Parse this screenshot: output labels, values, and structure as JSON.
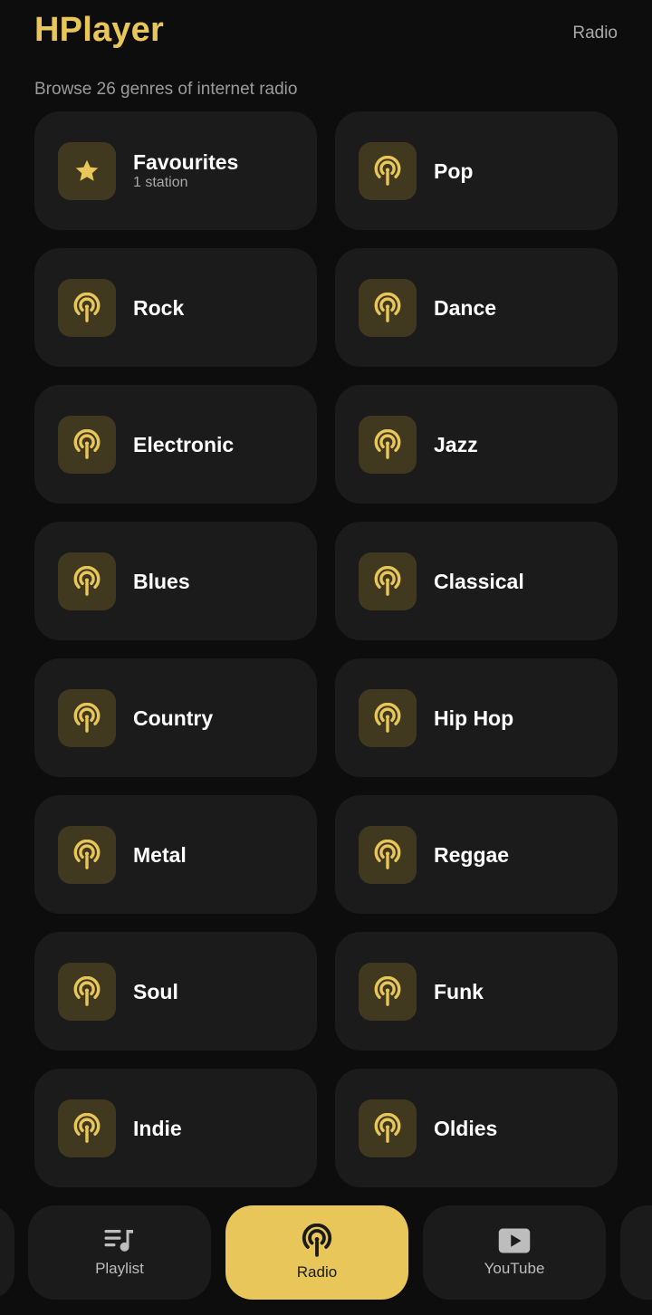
{
  "header": {
    "app_title": "HPlayer",
    "page_label": "Radio"
  },
  "subtitle": "Browse 26 genres of internet radio",
  "colors": {
    "accent": "#e8c65a",
    "card_bg": "#1b1b1b",
    "icon_bg": "#40391f",
    "background": "#0d0d0d"
  },
  "genres": [
    {
      "name": "Favourites",
      "sub": "1 station",
      "icon": "star-icon"
    },
    {
      "name": "Pop",
      "icon": "radio-broadcast-icon"
    },
    {
      "name": "Rock",
      "icon": "radio-broadcast-icon"
    },
    {
      "name": "Dance",
      "icon": "radio-broadcast-icon"
    },
    {
      "name": "Electronic",
      "icon": "radio-broadcast-icon"
    },
    {
      "name": "Jazz",
      "icon": "radio-broadcast-icon"
    },
    {
      "name": "Blues",
      "icon": "radio-broadcast-icon"
    },
    {
      "name": "Classical",
      "icon": "radio-broadcast-icon"
    },
    {
      "name": "Country",
      "icon": "radio-broadcast-icon"
    },
    {
      "name": "Hip Hop",
      "icon": "radio-broadcast-icon"
    },
    {
      "name": "Metal",
      "icon": "radio-broadcast-icon"
    },
    {
      "name": "Reggae",
      "icon": "radio-broadcast-icon"
    },
    {
      "name": "Soul",
      "icon": "radio-broadcast-icon"
    },
    {
      "name": "Funk",
      "icon": "radio-broadcast-icon"
    },
    {
      "name": "Indie",
      "icon": "radio-broadcast-icon"
    },
    {
      "name": "Oldies",
      "icon": "radio-broadcast-icon"
    }
  ],
  "bottom_nav": {
    "items": [
      {
        "label": "Playlist",
        "icon": "playlist-icon",
        "active": false
      },
      {
        "label": "Radio",
        "icon": "radio-broadcast-icon",
        "active": true
      },
      {
        "label": "YouTube",
        "icon": "youtube-play-icon",
        "active": false
      }
    ]
  }
}
